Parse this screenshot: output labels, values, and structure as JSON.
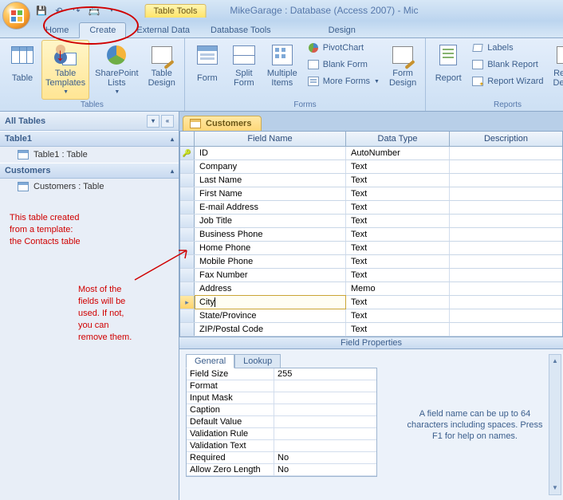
{
  "title": "MikeGarage : Database (Access 2007) - Mic",
  "tableTools": "Table Tools",
  "tabs": {
    "home": "Home",
    "create": "Create",
    "external": "External Data",
    "dbtools": "Database Tools",
    "design": "Design"
  },
  "ribbon": {
    "groups": {
      "tables": "Tables",
      "forms": "Forms",
      "reports": "Reports"
    },
    "table": "Table",
    "tableTemplates": "Table\nTemplates",
    "sharepoint": "SharePoint\nLists",
    "tableDesign": "Table\nDesign",
    "form": "Form",
    "splitForm": "Split\nForm",
    "multipleItems": "Multiple\nItems",
    "pivotChart": "PivotChart",
    "blankForm": "Blank Form",
    "moreForms": "More Forms",
    "formDesign": "Form\nDesign",
    "report": "Report",
    "labels": "Labels",
    "blankReport": "Blank Report",
    "reportWizard": "Report Wizard",
    "reportDesign": "Report\nDesign"
  },
  "nav": {
    "header": "All Tables",
    "group1": "Table1",
    "item1": "Table1 : Table",
    "group2": "Customers",
    "item2": "Customers : Table"
  },
  "docTab": "Customers",
  "headers": {
    "field": "Field Name",
    "type": "Data Type",
    "desc": "Description"
  },
  "fields": [
    {
      "name": "ID",
      "type": "AutoNumber",
      "pk": true
    },
    {
      "name": "Company",
      "type": "Text"
    },
    {
      "name": "Last Name",
      "type": "Text"
    },
    {
      "name": "First Name",
      "type": "Text"
    },
    {
      "name": "E-mail Address",
      "type": "Text"
    },
    {
      "name": "Job Title",
      "type": "Text"
    },
    {
      "name": "Business Phone",
      "type": "Text"
    },
    {
      "name": "Home Phone",
      "type": "Text"
    },
    {
      "name": "Mobile Phone",
      "type": "Text"
    },
    {
      "name": "Fax Number",
      "type": "Text"
    },
    {
      "name": "Address",
      "type": "Memo"
    },
    {
      "name": "City",
      "type": "Text",
      "active": true
    },
    {
      "name": "State/Province",
      "type": "Text"
    },
    {
      "name": "ZIP/Postal Code",
      "type": "Text"
    }
  ],
  "fieldPropsLabel": "Field Properties",
  "fpTabs": {
    "general": "General",
    "lookup": "Lookup"
  },
  "fieldProps": [
    {
      "k": "Field Size",
      "v": "255"
    },
    {
      "k": "Format",
      "v": ""
    },
    {
      "k": "Input Mask",
      "v": ""
    },
    {
      "k": "Caption",
      "v": ""
    },
    {
      "k": "Default Value",
      "v": ""
    },
    {
      "k": "Validation Rule",
      "v": ""
    },
    {
      "k": "Validation Text",
      "v": ""
    },
    {
      "k": "Required",
      "v": "No"
    },
    {
      "k": "Allow Zero Length",
      "v": "No"
    }
  ],
  "hint": "A field name can be up to 64 characters including spaces.  Press F1 for help on names.",
  "annot1": "This table created\nfrom a template:\nthe Contacts table",
  "annot2": "Most of the\nfields will be\nused. If not,\nyou can\nremove them."
}
